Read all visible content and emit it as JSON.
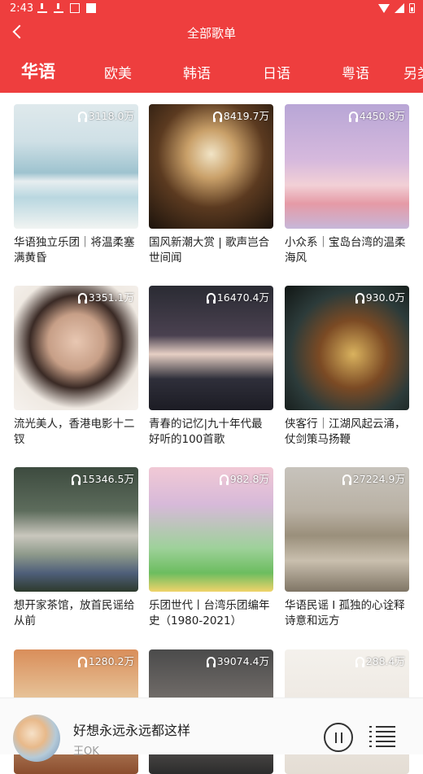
{
  "status": {
    "time": "2:43"
  },
  "header": {
    "title": "全部歌单",
    "tabs": [
      "华语",
      "欧美",
      "韩语",
      "日语",
      "粤语",
      "另类"
    ]
  },
  "playlists": [
    {
      "count": "3118.0万",
      "name": "华语独立乐团｜将温柔塞满黄昏",
      "bg": "linear-gradient(180deg,#dfe9ec 0%,#cfe0e6 30%,#9ec3cf 55%,#e7eef0 62%,#b9d7e0 75%,#f1f4f2 100%)"
    },
    {
      "count": "8419.7万",
      "name": "国风新潮大赏 | 歌声岂合世间闻",
      "bg": "radial-gradient(circle at 50% 40%,#f1e4c6 0%,#c9a069 25%,#5b3a20 55%,#1c130c 100%)"
    },
    {
      "count": "4450.8万",
      "name": "小众系｜宝岛台湾的温柔海风",
      "bg": "linear-gradient(180deg,#b8a6d6 0%,#d6b9dd 45%,#f2d0d6 65%,#e59aa6 80%,#c7b7d9 100%)"
    },
    {
      "count": "3351.1万",
      "name": "流光美人，香港电影十二钗",
      "bg": "radial-gradient(circle at 50% 45%,#e8c7b2 0%,#c79f87 30%,#3a2a25 50%,#efe9e2 72%,#f6f2ee 100%)"
    },
    {
      "count": "16470.4万",
      "name": "青春的记忆|九十年代最好听的100首歌",
      "bg": "linear-gradient(180deg,#2a2b33 0%,#4a4150 40%,#e6cfc4 55%,#2f2f3a 75%,#1c1c24 100%)"
    },
    {
      "count": "930.0万",
      "name": "侠客行｜江湖风起云涌，仗剑策马扬鞭",
      "bg": "radial-gradient(circle at 55% 55%,#d9b25e 0%,#7b4a24 35%,#2c3b3a 65%,#111614 100%)"
    },
    {
      "count": "15346.5万",
      "name": "想开家茶馆，放首民谣给从前",
      "bg": "linear-gradient(180deg,#3d4b3f 0%,#5d6c5c 35%,#c9c7bd 55%,#8e9a8b 70%,#4f5f7a 85%,#2d3a2c 100%)"
    },
    {
      "count": "982.8万",
      "name": "乐团世代丨台湾乐团编年史（1980-2021）",
      "bg": "linear-gradient(180deg,#f1c9d5 0%,#d7b9d9 30%,#9ed19a 65%,#6cbd5f 85%,#f0d36a 100%)"
    },
    {
      "count": "27224.9万",
      "name": "华语民谣 I 孤独的心诠释诗意和远方",
      "bg": "linear-gradient(180deg,#c7c3bc 0%,#b9b1a4 35%,#9a8f7b 55%,#c9bfae 75%,#7f7565 100%)"
    },
    {
      "count": "1280.2万",
      "name": "",
      "bg": "linear-gradient(180deg,#d98e5a 0%,#e7c49a 40%,#8b4d2e 100%)"
    },
    {
      "count": "39074.4万",
      "name": "",
      "bg": "linear-gradient(180deg,#4b4b4b 0%,#7a7470 50%,#2c2c2c 100%)"
    },
    {
      "count": "288.4万",
      "name": "",
      "bg": "linear-gradient(180deg,#f4f1ec 0%,#ece6df 60%,#e4ddd4 100%)"
    }
  ],
  "player": {
    "song": "好想永远永远都这样",
    "artist": "王OK"
  },
  "colors": {
    "accent": "#ee3e3e"
  }
}
